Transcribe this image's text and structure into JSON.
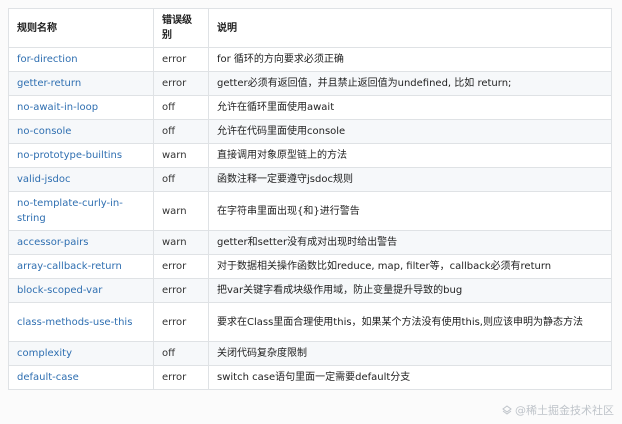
{
  "table": {
    "headers": [
      "规则名称",
      "错误级别",
      "说明"
    ],
    "rows": [
      {
        "name": "for-direction",
        "level": "error",
        "desc": "for 循环的方向要求必须正确"
      },
      {
        "name": "getter-return",
        "level": "error",
        "desc": "getter必须有返回值，并且禁止返回值为undefined, 比如 return;"
      },
      {
        "name": "no-await-in-loop",
        "level": "off",
        "desc": "允许在循环里面使用await"
      },
      {
        "name": "no-console",
        "level": "off",
        "desc": "允许在代码里面使用console"
      },
      {
        "name": "no-prototype-builtins",
        "level": "warn",
        "desc": "直接调用对象原型链上的方法"
      },
      {
        "name": "valid-jsdoc",
        "level": "off",
        "desc": "函数注释一定要遵守jsdoc规则"
      },
      {
        "name": "no-template-curly-in-string",
        "level": "warn",
        "desc": "在字符串里面出现{和}进行警告"
      },
      {
        "name": "accessor-pairs",
        "level": "warn",
        "desc": "getter和setter没有成对出现时给出警告"
      },
      {
        "name": "array-callback-return",
        "level": "error",
        "desc": "对于数据相关操作函数比如reduce, map, filter等，callback必须有return"
      },
      {
        "name": "block-scoped-var",
        "level": "error",
        "desc": "把var关键字看成块级作用域，防止变量提升导致的bug"
      },
      {
        "name": "class-methods-use-this",
        "level": "error",
        "desc": "要求在Class里面合理使用this，如果某个方法没有使用this,则应该申明为静态方法"
      },
      {
        "name": "complexity",
        "level": "off",
        "desc": "关闭代码复杂度限制"
      },
      {
        "name": "default-case",
        "level": "error",
        "desc": "switch case语句里面一定需要default分支"
      }
    ]
  },
  "watermark": {
    "text": "@稀土掘金技术社区",
    "icon": "juejin-logo-icon"
  },
  "colors": {
    "link": "#2f6fb1",
    "row_alt": "#f6f8fa",
    "border": "#dfe2e5"
  }
}
